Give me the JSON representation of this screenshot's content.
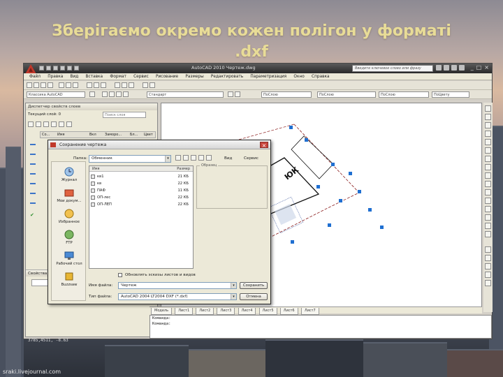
{
  "slide": {
    "title": "Зберігаємо окремо кожен полігон у форматі .dxf",
    "watermark": "sraki.livejournal.com",
    "coords_readout": "3785,4511, -8.63"
  },
  "app": {
    "title": "AutoCAD 2010   Чертеж.dwg",
    "search_placeholder": "Введите ключевое слово или фразу",
    "window_controls": [
      "_",
      "□",
      "×"
    ]
  },
  "menu": [
    "Файл",
    "Правка",
    "Вид",
    "Вставка",
    "Формат",
    "Сервис",
    "Рисование",
    "Размеры",
    "Редактировать",
    "Параметризация",
    "Окно",
    "Справка"
  ],
  "toolbars": {
    "workspace": "Классика AutoCAD",
    "layer": "Стандарт",
    "color": "ПоСлою",
    "linetype": "ПоСлою",
    "lineweight": "ПоСлою",
    "plotstyle": "ПоЦвету"
  },
  "palette": {
    "title": "Диспетчер свойств слоев",
    "current_layer": "Текущий слой: 0",
    "search": "Поиск слоя",
    "columns": [
      "Со...",
      "Имя",
      "Вкл",
      "Заморо...",
      "Бл...",
      "Цвет"
    ],
    "section2": "Свойства"
  },
  "drawing": {
    "label": "ЮК"
  },
  "dialog": {
    "title": "Сохранение чертежа",
    "folder_label": "Папка:",
    "folder_value": "Обменник",
    "columns": [
      "Имя",
      "Размер"
    ],
    "files": [
      {
        "name": "кв1",
        "size": "21 КБ"
      },
      {
        "name": "кв",
        "size": "22 КБ"
      },
      {
        "name": "ПАФ",
        "size": "11 КБ"
      },
      {
        "name": "ОП-лес",
        "size": "22 КБ"
      },
      {
        "name": "ОП-ЛЕП",
        "size": "22 КБ"
      }
    ],
    "places": [
      "Журнал",
      "Мои докум...",
      "Избранное",
      "FTP",
      "Рабочий стол",
      "Buzzsaw"
    ],
    "preview_label": "Образец",
    "checkbox_label": "Обновлять эскизы листов и видов",
    "filename_label": "Имя файла:",
    "filename_value": "Чертеж",
    "filetype_label": "Тип файла:",
    "filetype_value": "AutoCAD 2004 LT2004 DXF (*.dxf)",
    "save_button": "Сохранить",
    "cancel_button": "Отмена",
    "view_button": "Вид",
    "tools_button": "Сервис"
  },
  "tabs": [
    "Модель",
    "Лист1",
    "Лист2",
    "Лист3",
    "Лист4",
    "Лист5",
    "Лист6",
    "Лист7"
  ],
  "command_lines": [
    "Команда:",
    "Команда:"
  ],
  "colors": {
    "title": "#e8dc97",
    "drawing_bg": "#ffffff",
    "grip": "#1f6fd1"
  }
}
